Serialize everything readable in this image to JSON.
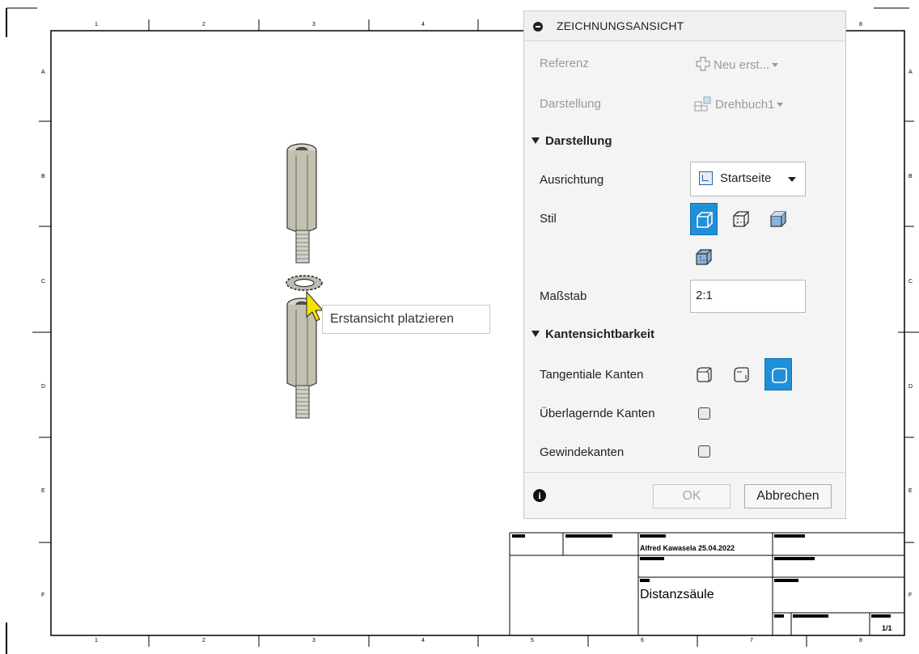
{
  "sheet": {
    "zone_columns": [
      "1",
      "2",
      "3",
      "4",
      "5",
      "6",
      "7",
      "8"
    ],
    "zone_rows": [
      "A",
      "B",
      "C",
      "D",
      "E",
      "F"
    ],
    "top_visible_columns": [
      "1",
      "2",
      "3",
      "4",
      "8"
    ]
  },
  "tooltip": {
    "text": "Erstansicht platzieren"
  },
  "dialog": {
    "title": "ZEICHNUNGSANSICHT",
    "referenz": {
      "label": "Referenz",
      "value": "Neu erst...",
      "icon": "plus-icon"
    },
    "darstellung_row": {
      "label": "Darstellung",
      "value": "Drehbuch1",
      "icon": "storyboard-icon"
    },
    "section_darstellung": "Darstellung",
    "ausrichtung": {
      "label": "Ausrichtung",
      "value": "Startseite",
      "icon": "home-view-icon"
    },
    "stil": {
      "label": "Stil",
      "options": [
        {
          "name": "visible-edges",
          "selected": true
        },
        {
          "name": "visible-and-hidden-edges",
          "selected": false
        },
        {
          "name": "shaded",
          "selected": false
        },
        {
          "name": "shaded-hidden-edges",
          "selected": false
        }
      ]
    },
    "massstab": {
      "label": "Maßstab",
      "value": "2:1"
    },
    "section_kanten": "Kantensichtbarkeit",
    "tangentiale": {
      "label": "Tangentiale Kanten",
      "options": [
        {
          "name": "full-length",
          "selected": false
        },
        {
          "name": "shortened",
          "selected": false
        },
        {
          "name": "off",
          "selected": true
        }
      ]
    },
    "ueberlagernde": {
      "label": "Überlagernde Kanten",
      "checked": false
    },
    "gewinde": {
      "label": "Gewindekanten",
      "checked": false
    },
    "ok_label": "OK",
    "cancel_label": "Abbrechen",
    "accent": "#1f8fd8"
  },
  "title_block": {
    "author_date": "Alfred Kawasela 25.04.2022",
    "drawing_title": "Distanzsäule",
    "sheet_number": "1/1"
  }
}
